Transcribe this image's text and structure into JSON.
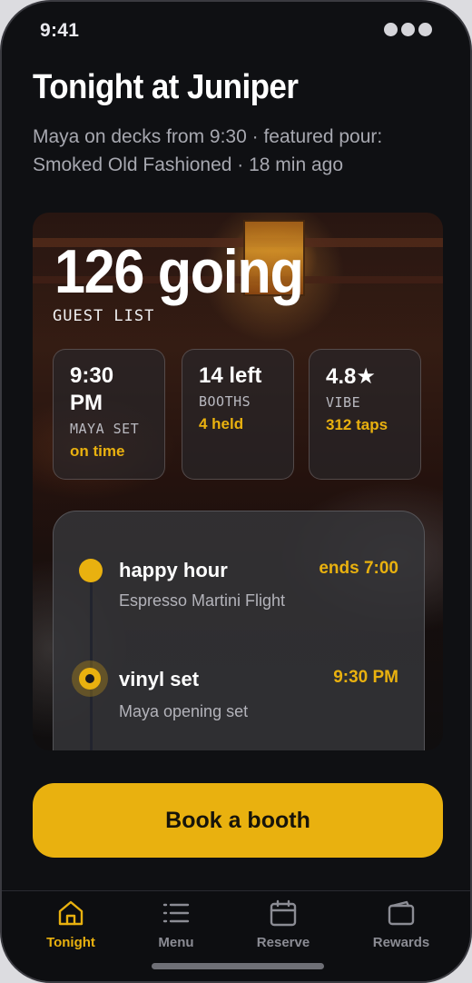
{
  "status_bar": {
    "time": "9:41"
  },
  "header": {
    "title": "Tonight at Juniper",
    "subtitle": "Maya on decks from 9:30 · featured pour: Smoked Old Fashioned · 18 min ago"
  },
  "hero": {
    "count": "126 going",
    "count_label": "GUEST LIST",
    "stats": [
      {
        "value": "9:30 PM",
        "key": "MAYA SET",
        "note": "on time"
      },
      {
        "value": "14 left",
        "key": "BOOTHS",
        "note": "4 held"
      },
      {
        "value": "4.8",
        "key": "VIBE",
        "note": "312 taps"
      }
    ]
  },
  "timeline": {
    "events": [
      {
        "title": "happy hour",
        "description": "Espresso Martini Flight",
        "time": "ends 7:00"
      },
      {
        "title": "vinyl set",
        "description": "Maya opening set",
        "time": "9:30 PM"
      }
    ]
  },
  "cta": {
    "label": "Book a booth"
  },
  "tabbar": {
    "items": [
      {
        "label": "Tonight",
        "icon": "home-icon",
        "active": true
      },
      {
        "label": "Menu",
        "icon": "list-icon",
        "active": false
      },
      {
        "label": "Reserve",
        "icon": "calendar-icon",
        "active": false
      },
      {
        "label": "Rewards",
        "icon": "wallet-icon",
        "active": false
      }
    ]
  },
  "colors": {
    "accent": "#e9b10f",
    "background": "#0f1013",
    "muted": "#8b8c94"
  }
}
